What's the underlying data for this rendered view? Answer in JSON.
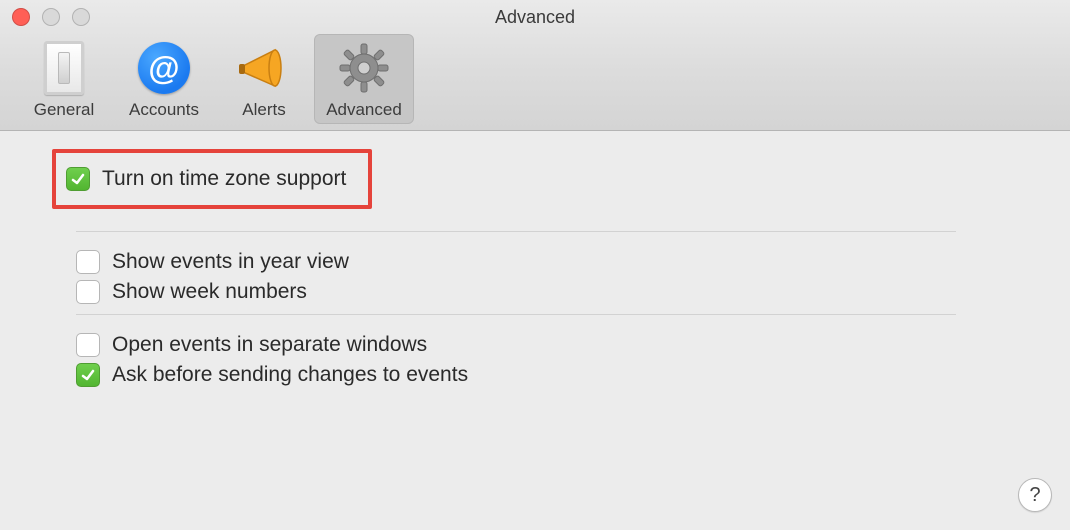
{
  "window": {
    "title": "Advanced"
  },
  "toolbar": {
    "items": [
      {
        "label": "General",
        "icon": "switch-icon",
        "active": false
      },
      {
        "label": "Accounts",
        "icon": "at-icon",
        "active": false
      },
      {
        "label": "Alerts",
        "icon": "megaphone-icon",
        "active": false
      },
      {
        "label": "Advanced",
        "icon": "gear-icon",
        "active": true
      }
    ]
  },
  "settings": {
    "timezone": {
      "label": "Turn on time zone support",
      "checked": true
    },
    "year_view": {
      "label": "Show events in year view",
      "checked": false
    },
    "week_numbers": {
      "label": "Show week numbers",
      "checked": false
    },
    "separate_win": {
      "label": "Open events in separate windows",
      "checked": false
    },
    "ask_changes": {
      "label": "Ask before sending changes to events",
      "checked": true
    }
  },
  "help_label": "?"
}
